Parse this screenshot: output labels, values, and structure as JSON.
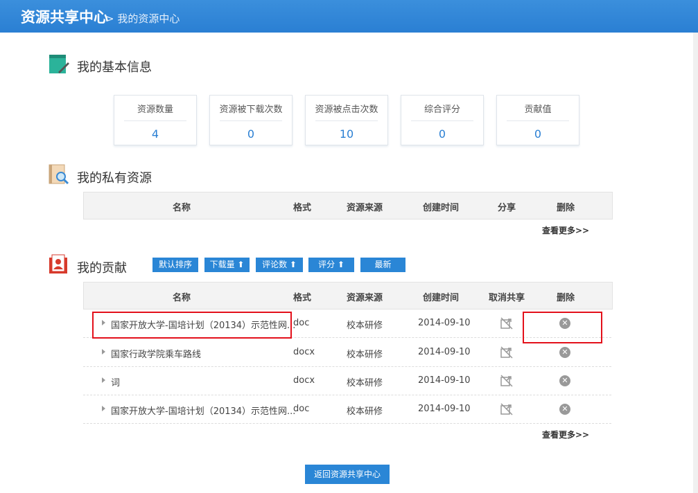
{
  "header": {
    "title": "资源共享中心",
    "breadcrumb": "> 我的资源中心"
  },
  "basic": {
    "title": "我的基本信息",
    "stats": [
      {
        "label": "资源数量",
        "value": "4"
      },
      {
        "label": "资源被下载次数",
        "value": "0"
      },
      {
        "label": "资源被点击次数",
        "value": "10"
      },
      {
        "label": "综合评分",
        "value": "0"
      },
      {
        "label": "贡献值",
        "value": "0"
      }
    ]
  },
  "private": {
    "title": "我的私有资源",
    "columns": [
      "名称",
      "格式",
      "资源来源",
      "创建时间",
      "分享",
      "删除"
    ],
    "more": "查看更多>>"
  },
  "contrib": {
    "title": "我的贡献",
    "sort_buttons": [
      "默认排序",
      "下载量 ⬆",
      "评论数 ⬆",
      "评分 ⬆",
      "最新"
    ],
    "columns": [
      "名称",
      "格式",
      "资源来源",
      "创建时间",
      "取消共享",
      "删除"
    ],
    "rows": [
      {
        "name": "国家开放大学-国培计划（20134）示范性网...",
        "format": "doc",
        "source": "校本研修",
        "date": "2014-09-10"
      },
      {
        "name": "国家行政学院乘车路线",
        "format": "docx",
        "source": "校本研修",
        "date": "2014-09-10"
      },
      {
        "name": "词",
        "format": "docx",
        "source": "校本研修",
        "date": "2014-09-10"
      },
      {
        "name": "国家开放大学-国培计划（20134）示范性网...",
        "format": "doc",
        "source": "校本研修",
        "date": "2014-09-10"
      }
    ],
    "more": "查看更多>>"
  },
  "footer": {
    "back_label": "返回资源共享中心"
  },
  "icons": {
    "basic": "notepad-icon",
    "private": "search-document-icon",
    "contrib": "user-badge-icon",
    "unshare": "unshare-icon",
    "delete": "delete-icon"
  },
  "colors": {
    "accent": "#2a86d6",
    "highlight": "#e3101a"
  }
}
